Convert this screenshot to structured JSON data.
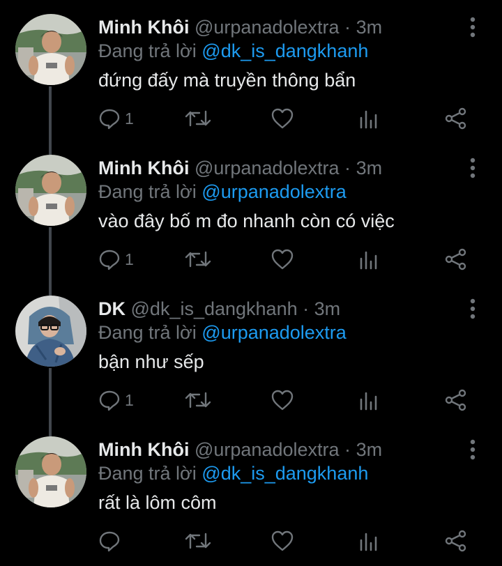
{
  "colors": {
    "background": "#000000",
    "text_primary": "#e7e9ea",
    "text_secondary": "#71767b",
    "mention": "#1d9bf0",
    "thread_line": "#42474d"
  },
  "tweets": [
    {
      "name": "Minh Khôi",
      "handle": "@urpanadolextra",
      "separator": "·",
      "time": "3m",
      "reply_prefix": "Đang trả lời",
      "reply_to": "@dk_is_dangkhanh",
      "text": "đứng đấy mà truyền thông bẩn",
      "reply_count": "1",
      "avatar": "photo of man in white tank top outdoors"
    },
    {
      "name": "Minh Khôi",
      "handle": "@urpanadolextra",
      "separator": "·",
      "time": "3m",
      "reply_prefix": "Đang trả lời",
      "reply_to": "@urpanadolextra",
      "text": "vào đây bố m đo nhanh còn có việc",
      "reply_count": "1",
      "avatar": "photo of man in white tank top outdoors"
    },
    {
      "name": "DK",
      "handle": "@dk_is_dangkhanh",
      "separator": "·",
      "time": "3m",
      "reply_prefix": "Đang trả lời",
      "reply_to": "@urpanadolextra",
      "text": "bận như sếp",
      "reply_count": "1",
      "avatar": "photo of person in blue denim with glasses"
    },
    {
      "name": "Minh Khôi",
      "handle": "@urpanadolextra",
      "separator": "·",
      "time": "3m",
      "reply_prefix": "Đang trả lời",
      "reply_to": "@dk_is_dangkhanh",
      "text": "rất là lôm côm",
      "reply_count": "",
      "avatar": "photo of man in white tank top outdoors"
    }
  ],
  "icons": {
    "reply": "reply-bubble-icon",
    "retweet": "retweet-icon",
    "like": "heart-icon",
    "stats": "bar-chart-icon",
    "share": "share-icon",
    "more": "vertical-dots-icon"
  }
}
